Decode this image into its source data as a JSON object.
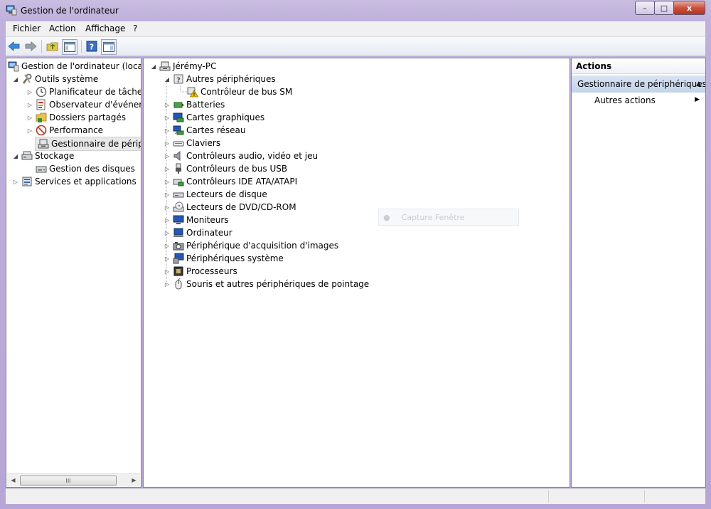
{
  "window": {
    "title": "Gestion de l'ordinateur"
  },
  "caption": {
    "minimize": "–",
    "maximize": "□",
    "close": "x"
  },
  "menu": [
    "Fichier",
    "Action",
    "Affichage",
    "?"
  ],
  "left_tree": {
    "root": "Gestion de l'ordinateur (local)",
    "outils": "Outils système",
    "planificateur": "Planificateur de tâches",
    "observateur": "Observateur d'événeme",
    "dossiers": "Dossiers partagés",
    "performance": "Performance",
    "gestionnaire": "Gestionnaire de périphé",
    "stockage": "Stockage",
    "disques": "Gestion des disques",
    "services": "Services et applications"
  },
  "scrollbar": {
    "left": "◀",
    "right": "▶",
    "grip": "III"
  },
  "device_tree": {
    "computer": "Jérémy-PC",
    "autres": "Autres périphériques",
    "bus_sm": "Contrôleur de bus SM",
    "categories": [
      "Batteries",
      "Cartes graphiques",
      "Cartes réseau",
      "Claviers",
      "Contrôleurs audio, vidéo et jeu",
      "Contrôleurs de bus USB",
      "Contrôleurs IDE ATA/ATAPI",
      "Lecteurs de disque",
      "Lecteurs de DVD/CD-ROM",
      "Moniteurs",
      "Ordinateur",
      "Périphérique d'acquisition d'images",
      "Périphériques système",
      "Processeurs",
      "Souris et autres périphériques de pointage"
    ]
  },
  "actions": {
    "header": "Actions",
    "section": "Gestionnaire de périphériques",
    "item": "Autres actions"
  },
  "overlay": {
    "text": "Capture Fenêtre"
  },
  "colors": {
    "accent": "#c3d3ea",
    "titlebar": "#bfb0dc",
    "warning": "#f2c200"
  }
}
